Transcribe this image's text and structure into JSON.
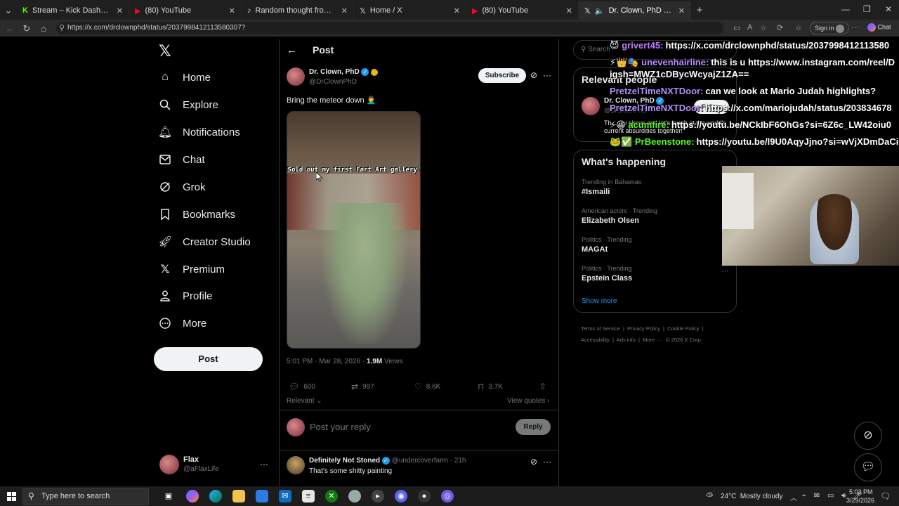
{
  "browser": {
    "tabs": [
      {
        "title": "Stream – Kick Dashboard",
        "icon": "kick-icon",
        "color": "#53fc18"
      },
      {
        "title": "(80) YouTube",
        "icon": "youtube-icon",
        "color": "#ff0033"
      },
      {
        "title": "Random thought from my brain a",
        "icon": "tiktok-icon",
        "color": "#ffffff"
      },
      {
        "title": "Home / X",
        "icon": "x-icon",
        "color": "#ffffff"
      },
      {
        "title": "(80) YouTube",
        "icon": "youtube-icon",
        "color": "#ff0033"
      },
      {
        "title": "Dr. Clown, PhD on X: \"Bring th",
        "icon": "x-icon",
        "color": "#ffffff"
      }
    ],
    "url": "https://x.com/drclownphd/status/2037998412113580307?",
    "signin_label": "Sign in",
    "chat_label": "Chat"
  },
  "sidebar": {
    "items": [
      {
        "label": "Home",
        "icon": "home-icon"
      },
      {
        "label": "Explore",
        "icon": "search-icon"
      },
      {
        "label": "Notifications",
        "icon": "bell-icon"
      },
      {
        "label": "Chat",
        "icon": "mail-icon"
      },
      {
        "label": "Grok",
        "icon": "grok-icon"
      },
      {
        "label": "Bookmarks",
        "icon": "bookmark-icon"
      },
      {
        "label": "Creator Studio",
        "icon": "rocket-icon"
      },
      {
        "label": "Premium",
        "icon": "x-icon"
      },
      {
        "label": "Profile",
        "icon": "person-icon"
      },
      {
        "label": "More",
        "icon": "more-circle-icon"
      }
    ],
    "post_label": "Post",
    "account": {
      "name": "Flax",
      "handle": "@aFlaxLife"
    }
  },
  "post": {
    "header_title": "Post",
    "author_name": "Dr. Clown, PhD",
    "author_handle": "@DrClownPhD",
    "subscribe_label": "Subscribe",
    "text": "Bring the meteor down 🤦‍♂️",
    "video_caption": "Sold out my first Fart Art gallery!",
    "timestamp": "5:01 PM · Mar 28, 2026 · ",
    "views_count": "1.9M",
    "views_label": " Views",
    "replies": "600",
    "reposts": "997",
    "likes": "8.6K",
    "bookmarks": "3.7K",
    "sort_label": "Relevant",
    "view_quotes_label": "View quotes",
    "reply_placeholder": "Post your reply",
    "reply_button": "Reply"
  },
  "reply": {
    "name": "Definitely Not Stoned",
    "handle": "@undercoverfarm",
    "time": "· 21h",
    "text": "That's some shitty painting"
  },
  "right": {
    "search_placeholder": "Search",
    "relevant_title": "Relevant people",
    "relevant_person": {
      "name": "Dr. Clown, PhD",
      "handle": "@DrClownPhD",
      "bio": "Th... my circus and let's laugh at the world's current absurdities together!",
      "follow": "Follow"
    },
    "happening_title": "What's happening",
    "trends": [
      {
        "meta": "Trending in Bahamas",
        "name": "#Ismaili"
      },
      {
        "meta": "American actors · Trending",
        "name": "Elizabeth Olsen"
      },
      {
        "meta": "Politics · Trending",
        "name": "MAGAt"
      },
      {
        "meta": "Politics · Trending",
        "name": "Epstein Class"
      }
    ],
    "show_more": "Show more",
    "footer_links": [
      "Terms of Service",
      "Privacy Policy",
      "Cookie Policy",
      "Accessibility",
      "Ads info",
      "More ···",
      "© 2026 X Corp."
    ]
  },
  "chat": [
    {
      "user": "grivert45:",
      "msg": "https://x.com/drclownphd/status/2037998412113580",
      "color": "#c27cff",
      "badges": "😈"
    },
    {
      "user": "unevenhairline:",
      "msg": "this is u https://www.instagram.com/reel/D",
      "color": "#b68cff",
      "badges": "⚡👑🎭"
    },
    {
      "user": "",
      "msg": "igsh=MWZ1cDBycWcyajZ1ZA==",
      "color": "#ffffff",
      "badges": ""
    },
    {
      "user": "PretzelTimeNXTDoor:",
      "msg": "can we look at Mario Judah highlights?",
      "color": "#b68cff",
      "badges": ""
    },
    {
      "user": "PretzelTimeNXTDoor:",
      "msg": "https://x.com/mariojudah/status/203834678",
      "color": "#b68cff",
      "badges": ""
    },
    {
      "user": "acumfire:",
      "msg": "https://youtu.be/NCkIbF6OhGs?si=6Z6c_LW42oiu0",
      "color": "#53fc18",
      "badges": "⚡😀"
    },
    {
      "user": "PrBeenstone:",
      "msg": "https://youtu.be/l9U0AqyJjno?si=wVjXDmDaCi",
      "color": "#53fc18",
      "badges": "🐸✅"
    }
  ],
  "taskbar": {
    "search_placeholder": "Type here to search",
    "weather": "24°C  Mostly cloudy",
    "time": "5:03 PM",
    "date": "3/29/2026"
  }
}
